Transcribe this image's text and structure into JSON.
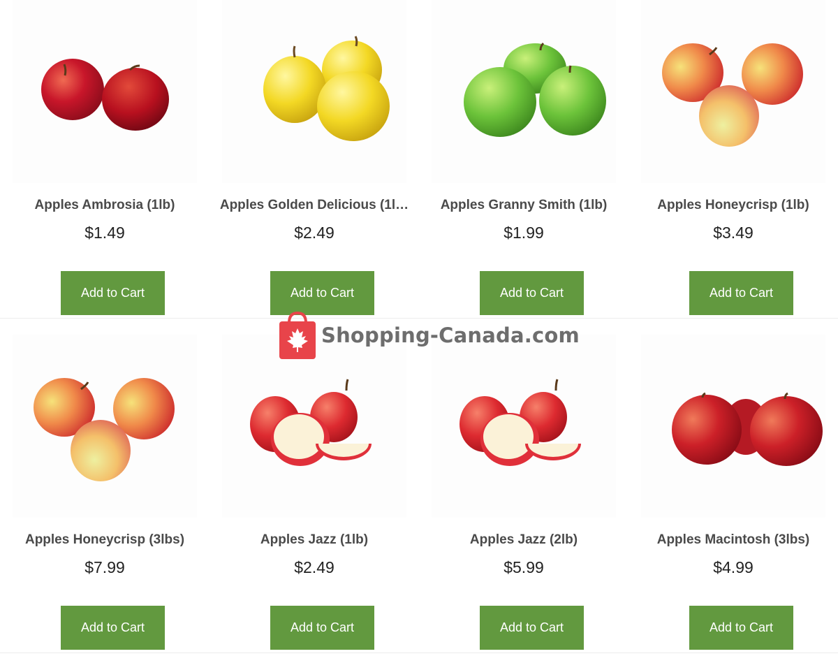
{
  "watermark": {
    "text": "Shopping-Canada.com"
  },
  "products": [
    {
      "name": "Apples Ambrosia (1lb)",
      "price": "$1.49",
      "button": "Add to Cart",
      "image": "red-apples-pair"
    },
    {
      "name": "Apples Golden Delicious (1l…",
      "price": "$2.49",
      "button": "Add to Cart",
      "image": "yellow-apples-trio"
    },
    {
      "name": "Apples Granny Smith (1lb)",
      "price": "$1.99",
      "button": "Add to Cart",
      "image": "green-apples-trio"
    },
    {
      "name": "Apples Honeycrisp (1lb)",
      "price": "$3.49",
      "button": "Add to Cart",
      "image": "honeycrisp-apples-trio"
    },
    {
      "name": "Apples Honeycrisp (3lbs)",
      "price": "$7.99",
      "button": "Add to Cart",
      "image": "honeycrisp-apples-trio"
    },
    {
      "name": "Apples Jazz (1lb)",
      "price": "$2.49",
      "button": "Add to Cart",
      "image": "sliced-red-apples"
    },
    {
      "name": "Apples Jazz (2lb)",
      "price": "$5.99",
      "button": "Add to Cart",
      "image": "sliced-red-apples"
    },
    {
      "name": "Apples Macintosh (3lbs)",
      "price": "$4.99",
      "button": "Add to Cart",
      "image": "red-apples-trio"
    }
  ],
  "colors": {
    "button": "#62993f",
    "button_text": "#ffffff",
    "name_text": "#4a4a4a",
    "watermark_red": "#e8444a"
  }
}
